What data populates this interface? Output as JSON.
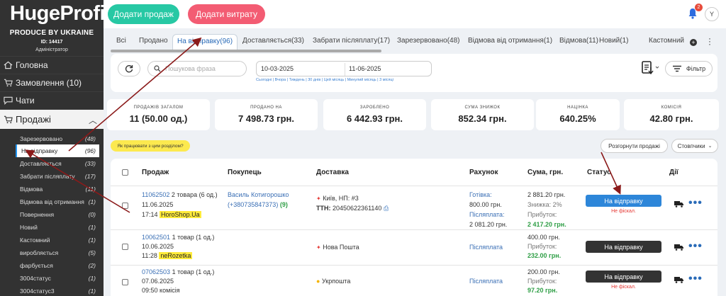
{
  "sidebar": {
    "logo": "HugeProfit",
    "tagline": "PRODUCE BY UKRAINE",
    "id_line": "ID: 14417",
    "role": "Адміністратор",
    "nav": [
      {
        "label": "Головна",
        "icon": "home-icon"
      },
      {
        "label": "Замовлення (10)",
        "icon": "cart-icon"
      },
      {
        "label": "Чати",
        "icon": "chat-icon"
      },
      {
        "label": "Продажі",
        "icon": "cart-icon"
      }
    ],
    "sub": [
      {
        "label": "Зарезервовано",
        "count": "(48)"
      },
      {
        "label": "На відправку",
        "count": "(96)"
      },
      {
        "label": "Доставляється",
        "count": "(33)"
      },
      {
        "label": "Забрати післяплату",
        "count": "(17)"
      },
      {
        "label": "Відмова",
        "count": "(11)"
      },
      {
        "label": "Відмова від отримання",
        "count": "(1)"
      },
      {
        "label": "Повернення",
        "count": "(0)"
      },
      {
        "label": "Новий",
        "count": "(1)"
      },
      {
        "label": "Кастомний",
        "count": "(1)"
      },
      {
        "label": "виробляється",
        "count": "(5)"
      },
      {
        "label": "фарбується",
        "count": "(2)"
      },
      {
        "label": "3004статус",
        "count": "(1)"
      },
      {
        "label": "3004статус3",
        "count": "(1)"
      }
    ]
  },
  "topbar": {
    "add_sale": "Додати продаж",
    "add_expense": "Додати витрату",
    "notif_count": "2",
    "avatar": "Y"
  },
  "tabs": [
    "Всі",
    "Продано",
    "На відправку(96)",
    "Доставляється(33)",
    "Забрати післяплату(17)",
    "Зарезервовано(48)",
    "Відмова від отримання(1)",
    "Відмова(11)",
    "Новий(1)",
    "Кастомний"
  ],
  "filters": {
    "search_placeholder": "Пошукова фраза",
    "date_from": "10-03-2025",
    "date_to": "11-06-2025",
    "quick": "Сьогодні | Вчора | Тиждень | 30 днів | Цей місяць | Минулий місяць | 3 місяці",
    "filter_label": "Фільтр"
  },
  "stats": [
    {
      "label": "ПРОДАЖІВ ЗАГАЛОМ",
      "value": "11 (50.00 од.)"
    },
    {
      "label": "ПРОДАНО НА",
      "value": "7 498.73 грн."
    },
    {
      "label": "ЗАРОБЛЕНО",
      "value": "6 442.93 грн."
    },
    {
      "label": "СУМА ЗНИЖОК",
      "value": "852.34 грн."
    },
    {
      "label": "НАЦІНКА",
      "value": "640.25%"
    },
    {
      "label": "КОМІСІЯ",
      "value": "42.80 грн."
    }
  ],
  "actions": {
    "hint": "Як працювати з цим розділом?",
    "expand": "Розгорнути продажі",
    "columns": "Стовпчики"
  },
  "table": {
    "headers": [
      "Продаж",
      "Покупець",
      "Доставка",
      "Рахунок",
      "Сума, грн.",
      "Статус",
      "Дії"
    ],
    "rows": [
      {
        "id": "11062502",
        "qty": "2 товара (6 од.)",
        "date": "11.06.2025",
        "time": "17:14",
        "source": "HoroShop.Ua",
        "buyer": "Василь Котигорошко",
        "phone": "(+380735847373)",
        "orders": "(9)",
        "delivery": "Київ, НП: #3",
        "ttn_label": "ТТН:",
        "ttn": "20450622361140",
        "pay1": "Готівка:",
        "pay1_amt": "800.00 грн.",
        "pay2": "Післяплата:",
        "pay2_amt": "2 081.20 грн.",
        "sum": "2 881.20 грн.",
        "discount": "Знижка: 2%",
        "profit_label": "Прибуток:",
        "profit": "2 417.20 грн.",
        "status": "На відправку",
        "status_color": "#2d86d9",
        "fiscal": "Не фіскал."
      },
      {
        "id": "10062501",
        "qty": "1 товар (1 од.)",
        "date": "10.06.2025",
        "time": "11:28",
        "source": "neRozetka",
        "delivery": "Нова Пошта",
        "pay1": "Післяплата",
        "sum": "400.00 грн.",
        "profit_label": "Прибуток:",
        "profit": "232.00 грн.",
        "status": "На відправку",
        "status_color": "#333333"
      },
      {
        "id": "07062503",
        "qty": "1 товар (1 од.)",
        "date": "07.06.2025",
        "time": "09:50",
        "source": "комісія",
        "delivery": "Укрпошта",
        "pay1": "Післяплата",
        "sum": "200.00 грн.",
        "profit_label": "Прибуток:",
        "profit": "97.20 грн.",
        "status": "На відправку",
        "status_color": "#333333",
        "fiscal": "Не фіскал."
      }
    ]
  }
}
